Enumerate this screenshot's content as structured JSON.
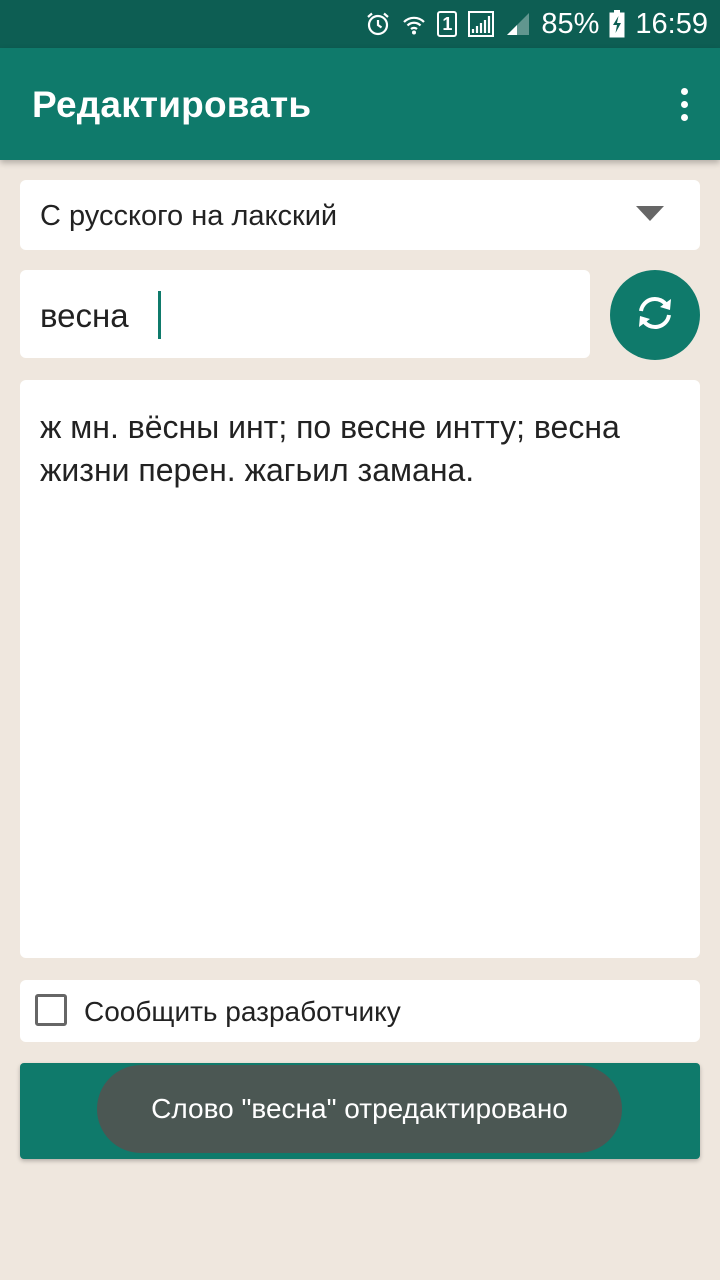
{
  "status_bar": {
    "battery": "85%",
    "time": "16:59",
    "sim_slot": "1",
    "icons": [
      "alarm-icon",
      "wifi-icon",
      "sim-icon",
      "signal-icon",
      "signal-weak-icon",
      "battery-charging-icon"
    ]
  },
  "app_bar": {
    "title": "Редактировать",
    "overflow_icon": "more-vert-icon"
  },
  "direction_spinner": {
    "value": "С русского на лакский",
    "icon": "dropdown-arrow-icon"
  },
  "word_input": {
    "value": "весна"
  },
  "swap_button": {
    "icon": "sync-icon"
  },
  "translation": {
    "text": "ж мн. вёсны инт; по весне интту; весна жизни перен. жагьил замана."
  },
  "report": {
    "label": "Сообщить разработчику",
    "checked": false
  },
  "toast": {
    "message": "Слово \"весна\" отредактировано"
  },
  "colors": {
    "primary": "#0f7a6b",
    "status_bar": "#0d5e53",
    "background": "#efe7de"
  }
}
